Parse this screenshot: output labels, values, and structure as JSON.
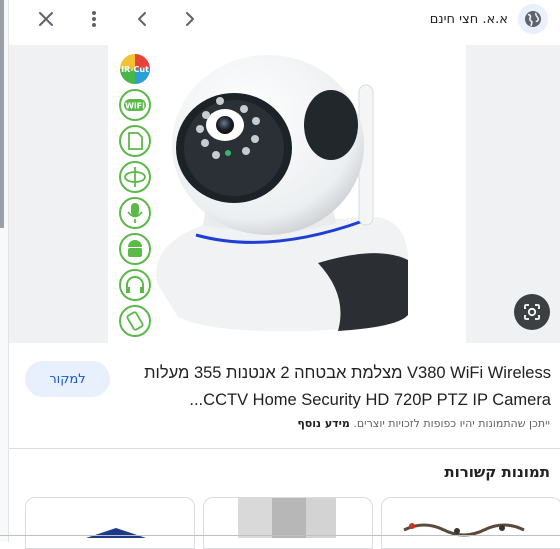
{
  "header": {
    "site_name": "א.א. חצי חינם",
    "icons": {
      "close": "close-icon",
      "more": "more-vert-icon",
      "back": "chevron-left-icon",
      "forward": "chevron-right-icon",
      "site": "globe-icon",
      "lens": "lens-icon"
    }
  },
  "image": {
    "badge_text": "IR-Cut",
    "wifi_text": "WiFi",
    "side_icons": [
      "ir-cut-icon",
      "wifi-icon",
      "sd-card-icon",
      "rotate-icon",
      "microphone-icon",
      "android-icon",
      "headphones-icon",
      "phone-rotate-icon"
    ]
  },
  "result": {
    "title": "V380 WiFi Wireless מצלמת אבטחה 2 אנטנות 355 מעלות CCTV Home Security HD 720P PTZ IP Camera...",
    "visit_label": "למקור",
    "notice_text": "ייתכן שהתמונות יהיו כפופות לזכויות יוצרים.",
    "learn_more": "מידע נוסף"
  },
  "related": {
    "heading": "תמונות קשורות"
  },
  "colors": {
    "accent": "#1a57c9",
    "chip_bg": "#e8f0fe",
    "icon_green": "#5bb947",
    "ring_blue": "#1e3fd6"
  }
}
